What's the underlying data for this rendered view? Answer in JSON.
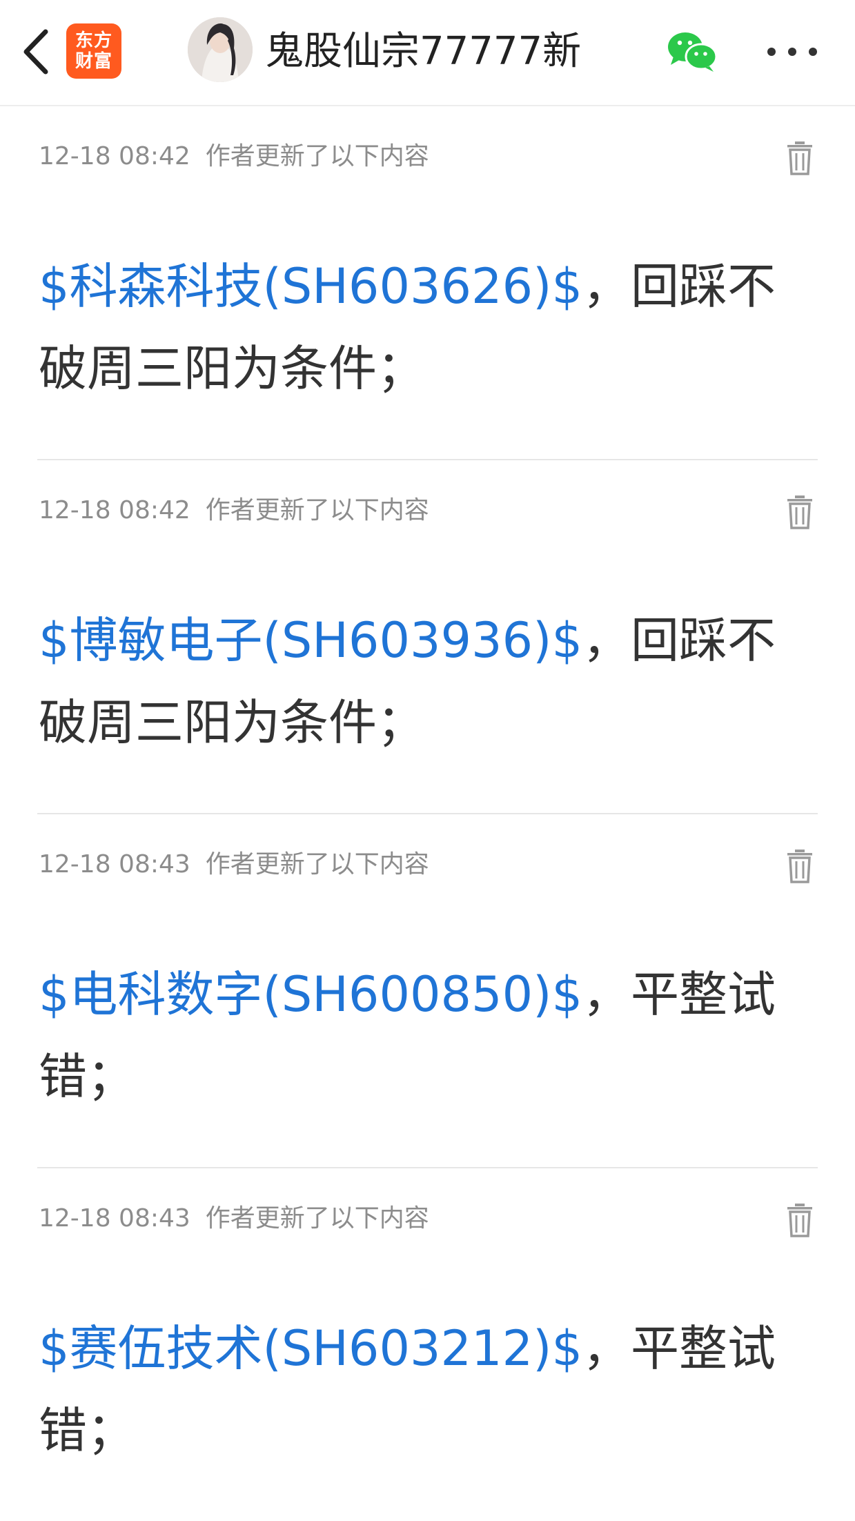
{
  "header": {
    "back_icon": "chevron-left-icon",
    "logo_line1": "东方",
    "logo_line2": "财富",
    "title": "鬼股仙宗77777新",
    "share_icon": "wechat-icon",
    "more_icon": "more-dots-icon"
  },
  "colors": {
    "link": "#1f74d6",
    "logo_bg": "#ff5a1f",
    "wechat": "#2bc84a"
  },
  "posts": [
    {
      "time": "12-18 08:42",
      "label": "作者更新了以下内容",
      "stock": "$科森科技(SH603626)$",
      "text": "，回踩不破周三阳为条件；"
    },
    {
      "time": "12-18 08:42",
      "label": "作者更新了以下内容",
      "stock": "$博敏电子(SH603936)$",
      "text": "，回踩不破周三阳为条件；"
    },
    {
      "time": "12-18 08:43",
      "label": "作者更新了以下内容",
      "stock": "$电科数字(SH600850)$",
      "text": "，平整试错；"
    },
    {
      "time": "12-18 08:43",
      "label": "作者更新了以下内容",
      "stock": "$赛伍技术(SH603212)$",
      "text": "，平整试错；"
    }
  ]
}
